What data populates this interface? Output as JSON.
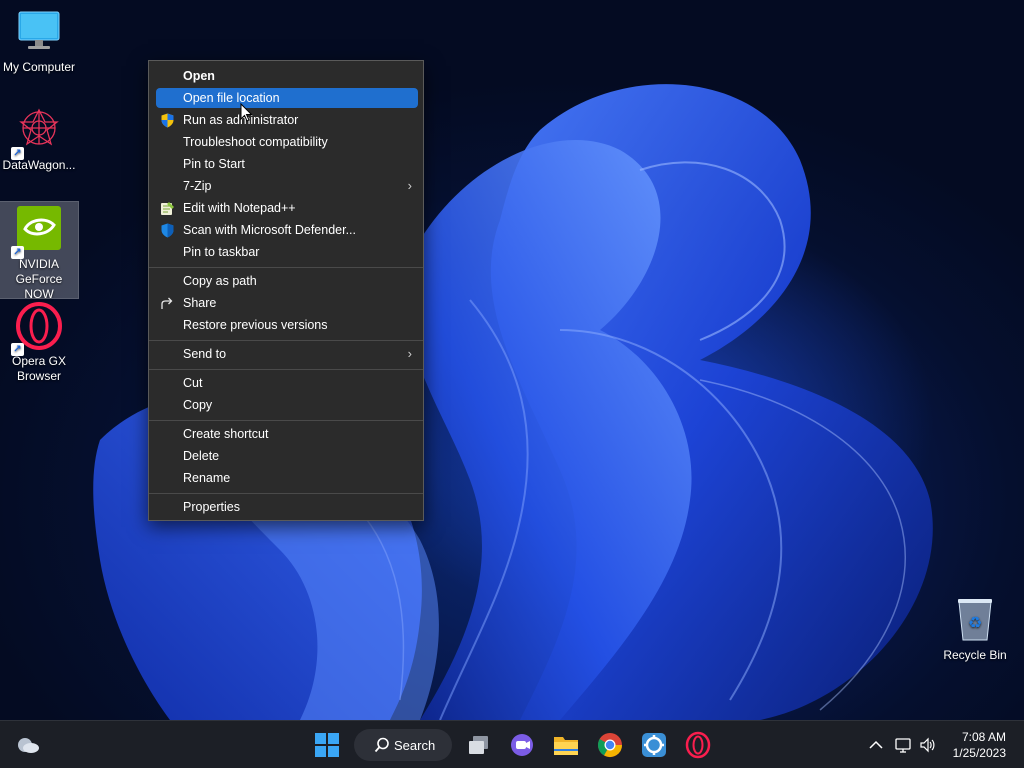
{
  "desktop": {
    "icons": [
      {
        "label": "My Computer"
      },
      {
        "label": "DataWagon..."
      },
      {
        "label": "NVIDIA GeForce NOW"
      },
      {
        "label": "Opera GX Browser"
      },
      {
        "label": "Recycle Bin"
      }
    ]
  },
  "context_menu": {
    "items": [
      {
        "label": "Open"
      },
      {
        "label": "Open file location"
      },
      {
        "label": "Run as administrator",
        "icon": "shield-icon"
      },
      {
        "label": "Troubleshoot compatibility"
      },
      {
        "label": "Pin to Start"
      },
      {
        "label": "7-Zip",
        "submenu": true
      },
      {
        "label": "Edit with Notepad++",
        "icon": "notepadpp-icon"
      },
      {
        "label": "Scan with Microsoft Defender...",
        "icon": "defender-icon"
      },
      {
        "label": "Pin to taskbar"
      },
      {
        "label": "Copy as path"
      },
      {
        "label": "Share",
        "icon": "share-icon"
      },
      {
        "label": "Restore previous versions"
      },
      {
        "label": "Send to",
        "submenu": true
      },
      {
        "label": "Cut"
      },
      {
        "label": "Copy"
      },
      {
        "label": "Create shortcut"
      },
      {
        "label": "Delete"
      },
      {
        "label": "Rename"
      },
      {
        "label": "Properties"
      }
    ],
    "submenu_arrow": "›"
  },
  "taskbar": {
    "search_label": "Search",
    "clock": {
      "time": "7:08 AM",
      "date": "1/25/2023"
    }
  },
  "colors": {
    "menu_bg": "#2b2b2b",
    "menu_highlight": "#1f6fcf",
    "taskbar_bg": "#1c1f26"
  }
}
